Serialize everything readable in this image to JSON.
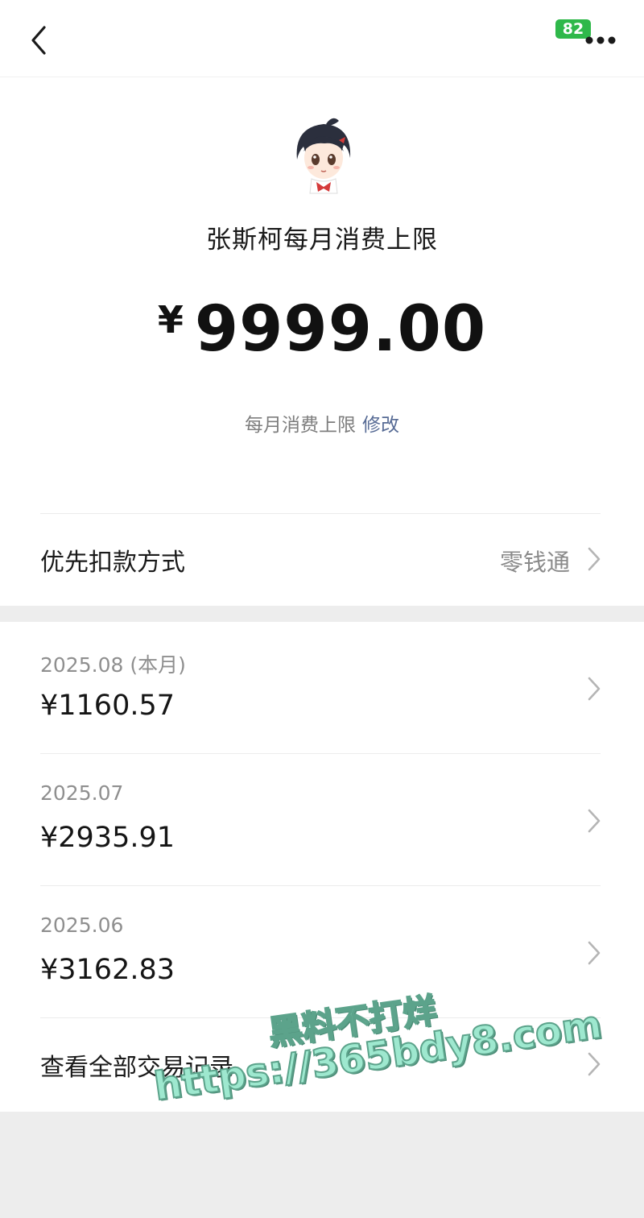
{
  "header": {
    "badge": "82"
  },
  "hero": {
    "title": "张斯柯每月消费上限",
    "currency": "¥",
    "amount": "9999.00",
    "sub_label": "每月消费上限",
    "edit_label": "修改"
  },
  "payment": {
    "label": "优先扣款方式",
    "value": "零钱通"
  },
  "months": [
    {
      "date": "2025.08 (本月)",
      "amount": "¥1160.57"
    },
    {
      "date": "2025.07",
      "amount": "¥2935.91"
    },
    {
      "date": "2025.06",
      "amount": "¥3162.83"
    }
  ],
  "all_records_label": "查看全部交易记录",
  "watermark": {
    "line1": "黑料不打烊",
    "line2": "https://365bdy8.com"
  },
  "colors": {
    "link": "#576b95",
    "badge": "#2fb84a",
    "background": "#ededed"
  },
  "icons": [
    "back-icon",
    "more-icon",
    "chevron-right-icon"
  ]
}
